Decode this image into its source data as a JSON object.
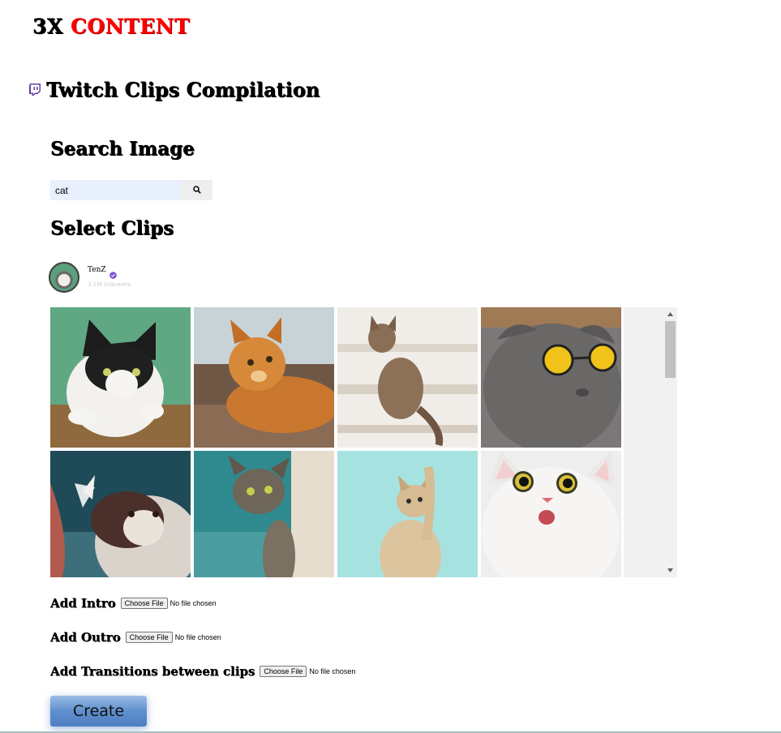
{
  "logo": {
    "part_a": "3X ",
    "part_b": "CONTENT"
  },
  "page": {
    "title": "Twitch Clips Compilation",
    "icon": "twitch-icon"
  },
  "search": {
    "title": "Search Image",
    "value": "cat",
    "button_icon": "search-icon"
  },
  "clips": {
    "title": "Select Clips",
    "channel": {
      "name": "TenZ",
      "followers": "3.1M followers",
      "verified_icon": "verified-icon"
    },
    "images": [
      {
        "subject": "black and white cat on green background"
      },
      {
        "subject": "orange tabby cat lying on floor"
      },
      {
        "subject": "tabby cat on stairs"
      },
      {
        "subject": "grey scottish fold with yellow sunglasses"
      },
      {
        "subject": "fluffy cat with butterfly"
      },
      {
        "subject": "tabby cat peeking"
      },
      {
        "subject": "kitten reaching on turquoise background"
      },
      {
        "subject": "surprised white cat"
      }
    ]
  },
  "uploads": {
    "intro_label": "Add Intro",
    "outro_label": "Add Outro",
    "transitions_label": "Add Transitions between clips",
    "choose_file": "Choose File",
    "no_file": "No file chosen"
  },
  "actions": {
    "create_label": "Create"
  },
  "colors": {
    "accent_red": "#ff0000",
    "twitch_purple": "#6441a5",
    "button_blue": "#5f8fcf"
  }
}
